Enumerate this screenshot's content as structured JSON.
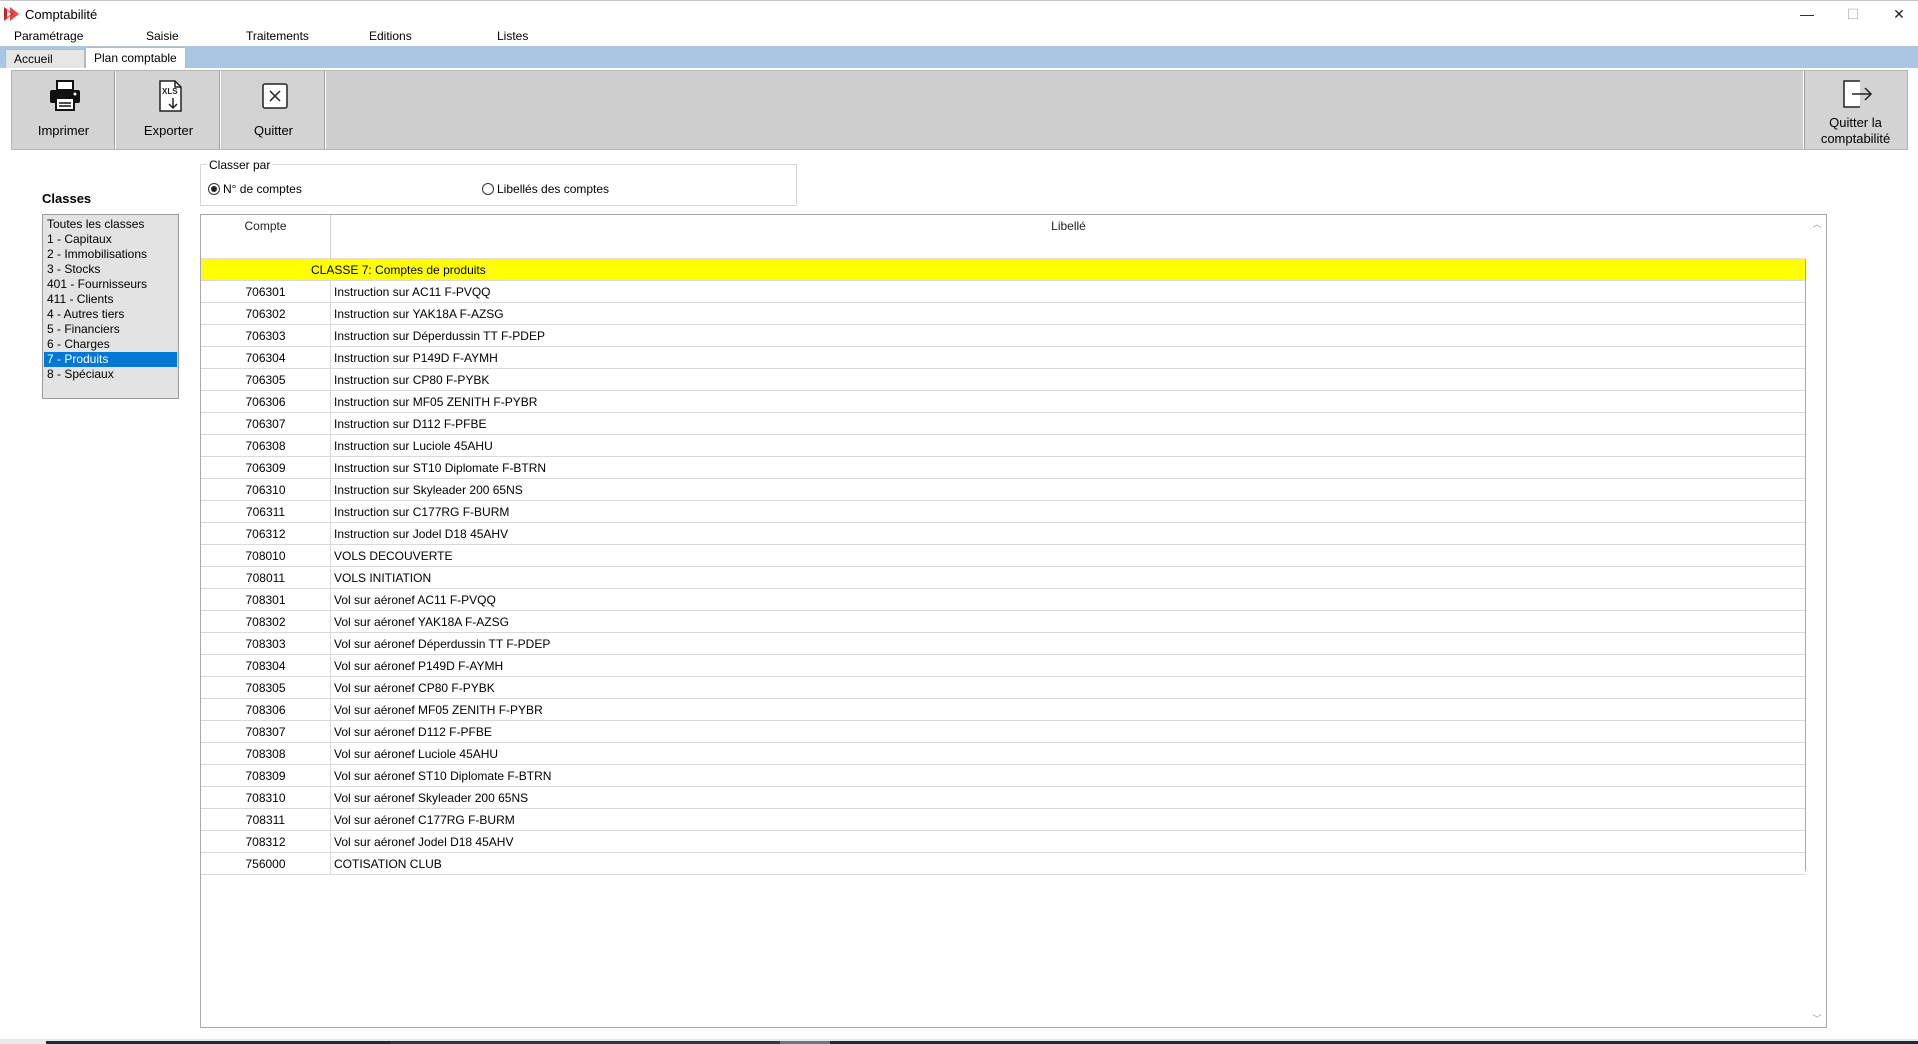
{
  "window": {
    "title": "Comptabilité",
    "min_glyph": "—",
    "max_glyph": "☐",
    "close_glyph": "✕"
  },
  "menu": [
    "Paramétrage",
    "Saisie",
    "Traitements",
    "Editions",
    "Listes"
  ],
  "tabs": [
    {
      "label": "Accueil",
      "active": false
    },
    {
      "label": "Plan comptable",
      "active": true
    }
  ],
  "toolbar": {
    "print_label": "Imprimer",
    "export_label": "Exporter",
    "quit_label": "Quitter",
    "quit_accounting_line1": "Quitter la",
    "quit_accounting_line2": "comptabilité",
    "export_icon_text": "XLS"
  },
  "classes": {
    "title": "Classes",
    "items": [
      "Toutes les classes",
      "1 - Capitaux",
      "2 - Immobilisations",
      "3 - Stocks",
      "401 - Fournisseurs",
      "411 - Clients",
      "4 - Autres tiers",
      "5 - Financiers",
      "6 - Charges",
      "7 - Produits",
      "8 - Spéciaux"
    ],
    "selected_index": 9
  },
  "sort": {
    "legend": "Classer par",
    "option_number": "N° de comptes",
    "option_label": "Libellés des comptes",
    "selected": "number"
  },
  "grid": {
    "col_compte": "Compte",
    "col_libelle": "Libellé",
    "class_header": "CLASSE 7: Comptes de produits",
    "rows": [
      {
        "compte": "706301",
        "libelle": "Instruction sur AC11 F-PVQQ"
      },
      {
        "compte": "706302",
        "libelle": "Instruction sur YAK18A F-AZSG"
      },
      {
        "compte": "706303",
        "libelle": "Instruction sur Déperdussin TT F-PDEP"
      },
      {
        "compte": "706304",
        "libelle": "Instruction sur P149D F-AYMH"
      },
      {
        "compte": "706305",
        "libelle": "Instruction sur CP80 F-PYBK"
      },
      {
        "compte": "706306",
        "libelle": "Instruction sur MF05 ZENITH F-PYBR"
      },
      {
        "compte": "706307",
        "libelle": "Instruction sur D112 F-PFBE"
      },
      {
        "compte": "706308",
        "libelle": "Instruction sur Luciole 45AHU"
      },
      {
        "compte": "706309",
        "libelle": "Instruction sur ST10 Diplomate F-BTRN"
      },
      {
        "compte": "706310",
        "libelle": "Instruction sur Skyleader 200 65NS"
      },
      {
        "compte": "706311",
        "libelle": "Instruction sur C177RG F-BURM"
      },
      {
        "compte": "706312",
        "libelle": "Instruction sur Jodel D18 45AHV"
      },
      {
        "compte": "708010",
        "libelle": "VOLS DECOUVERTE"
      },
      {
        "compte": "708011",
        "libelle": "VOLS INITIATION"
      },
      {
        "compte": "708301",
        "libelle": "Vol sur aéronef AC11 F-PVQQ"
      },
      {
        "compte": "708302",
        "libelle": "Vol sur aéronef YAK18A F-AZSG"
      },
      {
        "compte": "708303",
        "libelle": "Vol sur aéronef Déperdussin TT F-PDEP"
      },
      {
        "compte": "708304",
        "libelle": "Vol sur aéronef P149D F-AYMH"
      },
      {
        "compte": "708305",
        "libelle": "Vol sur aéronef CP80 F-PYBK"
      },
      {
        "compte": "708306",
        "libelle": "Vol sur aéronef MF05 ZENITH F-PYBR"
      },
      {
        "compte": "708307",
        "libelle": "Vol sur aéronef D112 F-PFBE"
      },
      {
        "compte": "708308",
        "libelle": "Vol sur aéronef Luciole 45AHU"
      },
      {
        "compte": "708309",
        "libelle": "Vol sur aéronef ST10 Diplomate F-BTRN"
      },
      {
        "compte": "708310",
        "libelle": "Vol sur aéronef Skyleader 200 65NS"
      },
      {
        "compte": "708311",
        "libelle": "Vol sur aéronef C177RG F-BURM"
      },
      {
        "compte": "708312",
        "libelle": "Vol sur aéronef Jodel D18 45AHV"
      },
      {
        "compte": "756000",
        "libelle": "COTISATION CLUB"
      }
    ]
  },
  "colors": {
    "tabstrip": "#a9c6e2",
    "toolbar": "#cfcfcf",
    "selection": "#0078d7",
    "class_header": "#ffff00"
  }
}
